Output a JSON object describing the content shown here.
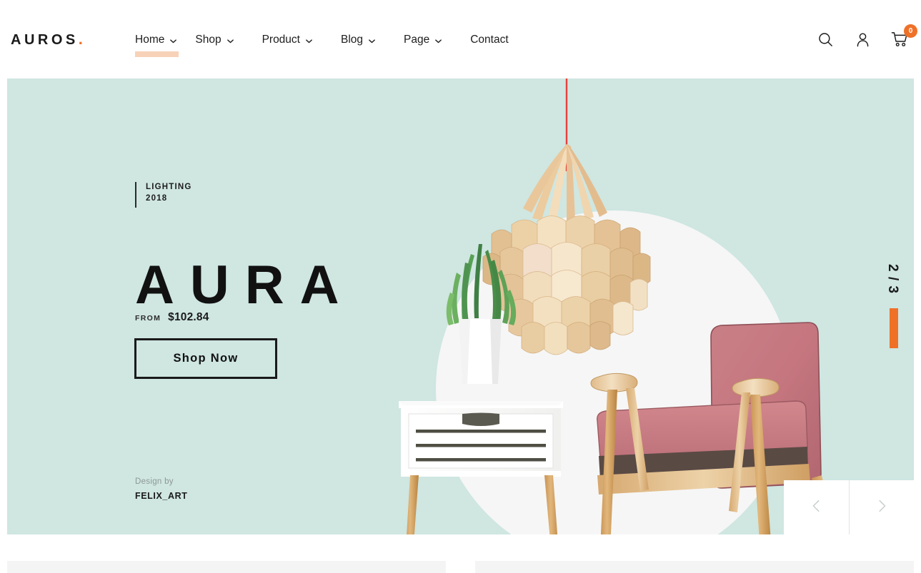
{
  "header": {
    "logo_text": "AUROS",
    "logo_dot": ".",
    "nav": [
      {
        "label": "Home",
        "has_chevron": true,
        "active": true,
        "icon": "chevron-down-icon"
      },
      {
        "label": "Shop",
        "has_chevron": true,
        "active": false,
        "icon": "chevron-down-icon"
      },
      {
        "label": "Product",
        "has_chevron": true,
        "active": false,
        "icon": "chevron-down-icon"
      },
      {
        "label": "Blog",
        "has_chevron": true,
        "active": false,
        "icon": "chevron-down-icon"
      },
      {
        "label": "Page",
        "has_chevron": true,
        "active": false,
        "icon": "chevron-down-icon"
      },
      {
        "label": "Contact",
        "has_chevron": false,
        "active": false,
        "icon": ""
      }
    ],
    "icons": {
      "search": "search-icon",
      "account": "user-icon",
      "cart": "shopping-cart-icon"
    },
    "cart_count": "0"
  },
  "hero": {
    "eyebrow_line1": "LIGHTING",
    "eyebrow_line2": "2018",
    "title": "AURA",
    "price_prefix": "FROM",
    "price": "$102.84",
    "cta_label": "Shop Now",
    "designer_label": "Design by",
    "designer_name": "FELIX_ART",
    "slide_counter": "2 / 3",
    "prev_icon": "chevron-left-icon",
    "next_icon": "chevron-right-icon"
  },
  "colors": {
    "hero_background": "#cfe6e1",
    "accent_orange": "#ef7128",
    "nav_highlight": "#f7d2b8",
    "circle": "#f6f6f6",
    "panel": "#f4f4f4",
    "text_dark": "#1a1a1a"
  }
}
